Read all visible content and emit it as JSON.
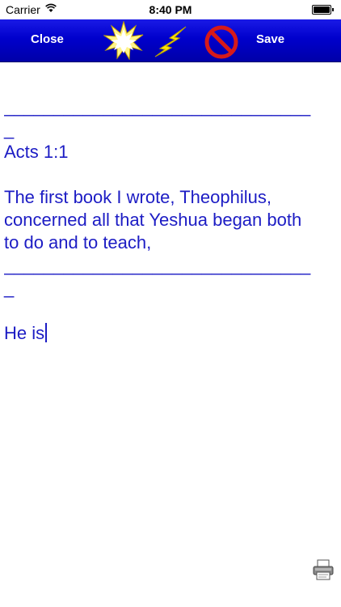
{
  "status_bar": {
    "carrier": "Carrier",
    "time": "8:40 PM"
  },
  "toolbar": {
    "close_label": "Close",
    "save_label": "Save",
    "icons": [
      "burst-icon",
      "lightning-icon",
      "no-sign-icon"
    ],
    "background_color": "#0000cc"
  },
  "editor": {
    "separator_1": "_______________________________",
    "separator_1_tail": "_",
    "reference": "Acts 1:1",
    "verse_line_1": "The first book I wrote, Theophilus,",
    "verse_line_2": "concerned all that Yeshua began both",
    "verse_line_3": "to do and to teach,",
    "separator_2": "_______________________________",
    "separator_2_tail": "_",
    "user_text": "He is",
    "text_color": "#1c1cc4"
  },
  "footer": {
    "print_icon": "printer-icon"
  }
}
